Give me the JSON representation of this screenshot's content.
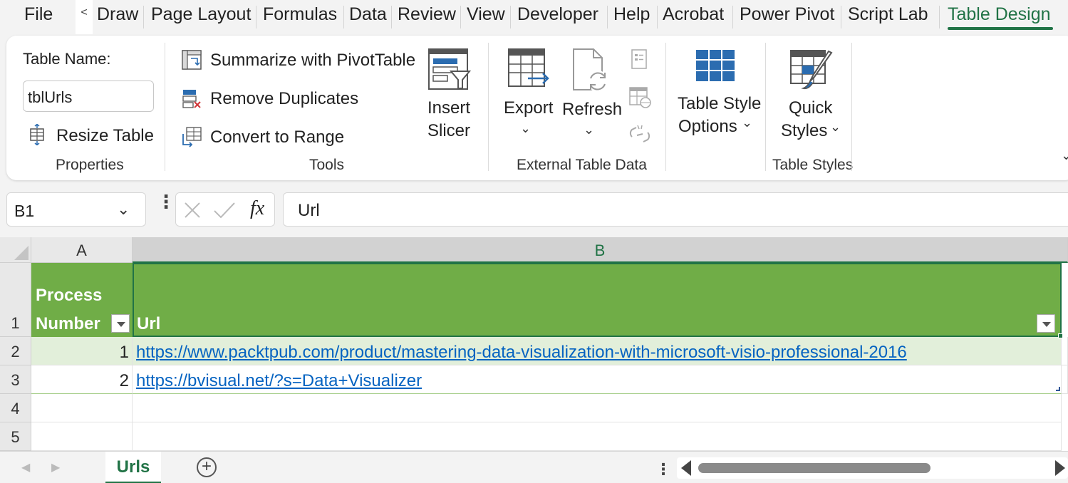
{
  "tabs": {
    "file": "File",
    "scroll_left": "<",
    "draw": "Draw",
    "page_layout": "Page Layout",
    "formulas": "Formulas",
    "data": "Data",
    "review": "Review",
    "view": "View",
    "developer": "Developer",
    "help": "Help",
    "acrobat": "Acrobat",
    "power_pivot": "Power Pivot",
    "script_lab": "Script Lab",
    "table_design": "Table Design"
  },
  "ribbon": {
    "properties": {
      "table_name_label": "Table Name:",
      "table_name_value": "tblUrls",
      "resize_table": "Resize Table",
      "group_label": "Properties"
    },
    "tools": {
      "summarize": "Summarize with PivotTable",
      "remove_duplicates": "Remove Duplicates",
      "convert_to_range": "Convert to Range",
      "insert_slicer_line1": "Insert",
      "insert_slicer_line2": "Slicer",
      "group_label": "Tools"
    },
    "external": {
      "export": "Export",
      "refresh": "Refresh",
      "group_label": "External Table Data"
    },
    "table_style_options": {
      "line1": "Table Style",
      "line2": "Options"
    },
    "table_styles": {
      "line1": "Quick",
      "line2": "Styles",
      "group_label": "Table Styles"
    }
  },
  "formula_bar": {
    "name_box": "B1",
    "fx": "fx",
    "value": "Url"
  },
  "grid": {
    "columns": [
      "A",
      "B"
    ],
    "rows": [
      "1",
      "2",
      "3",
      "4",
      "5"
    ],
    "header": {
      "col_a_line1": "Process",
      "col_a_line2": "Number",
      "col_b": "Url"
    },
    "data_rows": [
      {
        "number": "1",
        "url": "https://www.packtpub.com/product/mastering-data-visualization-with-microsoft-visio-professional-2016"
      },
      {
        "number": "2",
        "url": "https://bvisual.net/?s=Data+Visualizer"
      }
    ]
  },
  "sheets": {
    "active": "Urls",
    "add": "+"
  },
  "colors": {
    "accent": "#217346",
    "table_header": "#70ad47",
    "band": "#e2efda",
    "link": "#0563c1"
  }
}
